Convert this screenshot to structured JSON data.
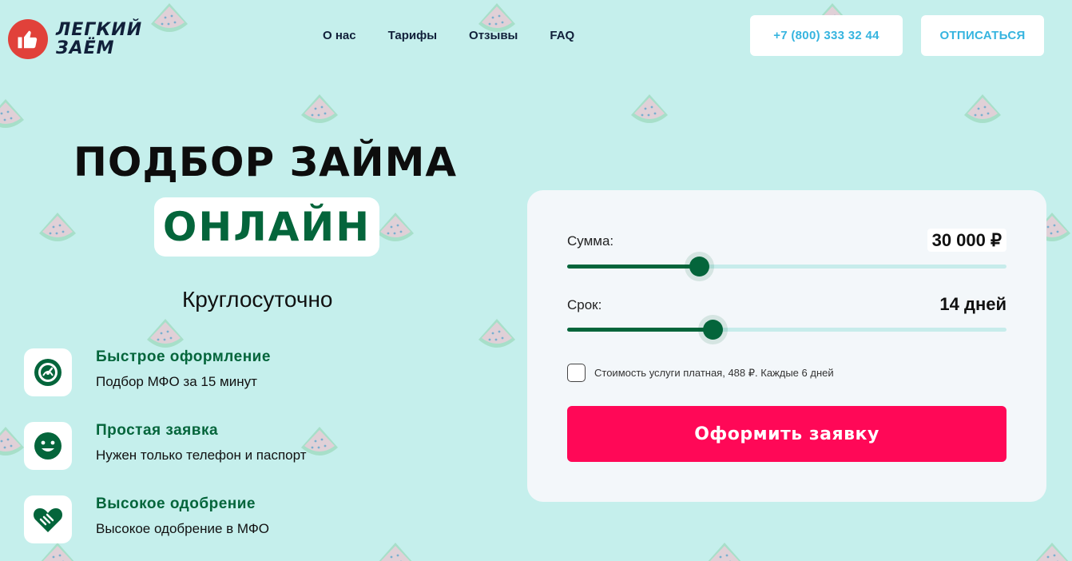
{
  "header": {
    "logo_line1": "ЛЕГКИЙ",
    "logo_line2": "ЗАЁМ",
    "nav": [
      "О нас",
      "Тарифы",
      "Отзывы",
      "FAQ"
    ],
    "phone": "+7 (800) 333 32 44",
    "unsubscribe": "ОТПИСАТЬСЯ"
  },
  "hero": {
    "title": "ПОДБОР ЗАЙМА",
    "highlight": "ОНЛАЙН",
    "subtitle": "Круглосуточно"
  },
  "features": [
    {
      "title": "Быстрое оформление",
      "desc": "Подбор МФО за 15 минут",
      "icon": "speedometer-icon"
    },
    {
      "title": "Простая заявка",
      "desc": "Нужен только телефон и паспорт",
      "icon": "smile-icon"
    },
    {
      "title": "Высокое одобрение",
      "desc": "Высокое одобрение в МФО",
      "icon": "handshake-heart-icon"
    }
  ],
  "form": {
    "amount_label": "Сумма:",
    "amount_value": "30 000 ₽",
    "amount_fill": 0.3,
    "term_label": "Срок:",
    "term_value": "14 дней",
    "term_fill": 0.33,
    "consent": "Стоимость услуги платная, 488 ₽. Каждые 6 дней",
    "submit": "Оформить заявку"
  },
  "colors": {
    "background": "#c5efec",
    "accent_green": "#04653b",
    "accent_pink": "#ff0857",
    "link_blue": "#36b4df",
    "logo_red": "#e1413a"
  }
}
